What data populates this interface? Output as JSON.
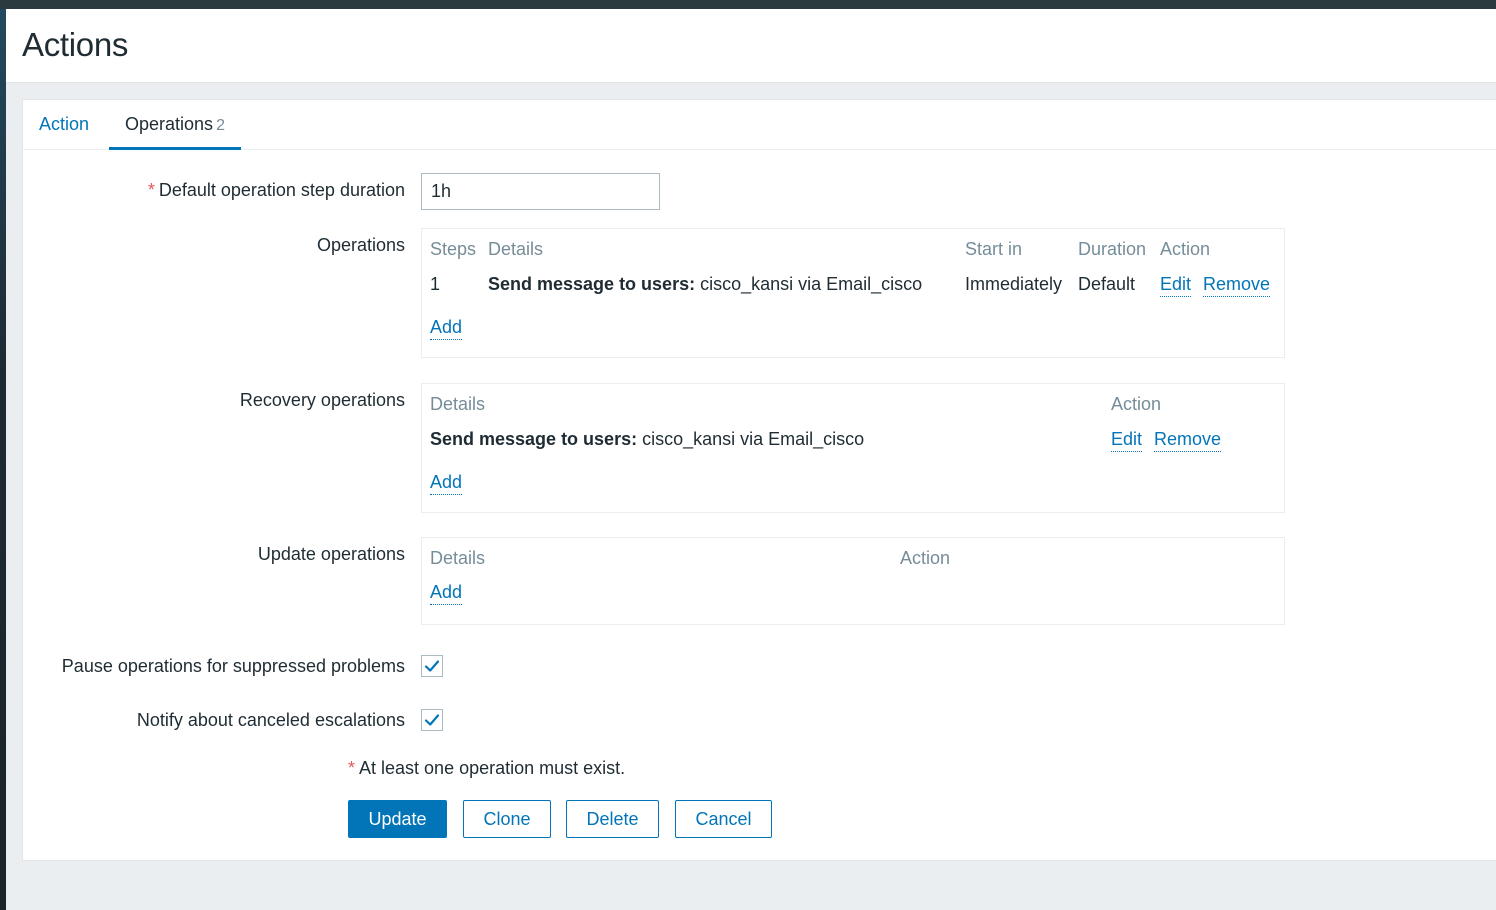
{
  "page": {
    "title": "Actions"
  },
  "tabs": [
    {
      "label": "Action"
    },
    {
      "label": "Operations",
      "count": "2"
    }
  ],
  "form": {
    "step_duration": {
      "label": "Default operation step duration",
      "value": "1h",
      "required_mark": "*"
    },
    "operations": {
      "label": "Operations",
      "headers": {
        "steps": "Steps",
        "details": "Details",
        "start_in": "Start in",
        "duration": "Duration",
        "action": "Action"
      },
      "rows": [
        {
          "step": "1",
          "details_bold": "Send message to users:",
          "details_rest": "cisco_kansi via Email_cisco",
          "start_in": "Immediately",
          "duration": "Default",
          "edit": "Edit",
          "remove": "Remove"
        }
      ],
      "add_label": "Add"
    },
    "recovery_operations": {
      "label": "Recovery operations",
      "headers": {
        "details": "Details",
        "action": "Action"
      },
      "rows": [
        {
          "details_bold": "Send message to users:",
          "details_rest": "cisco_kansi via Email_cisco",
          "edit": "Edit",
          "remove": "Remove"
        }
      ],
      "add_label": "Add"
    },
    "update_operations": {
      "label": "Update operations",
      "headers": {
        "details": "Details",
        "action": "Action"
      },
      "add_label": "Add"
    },
    "pause_suppressed": {
      "label": "Pause operations for suppressed problems",
      "checked": true
    },
    "notify_canceled": {
      "label": "Notify about canceled escalations",
      "checked": true
    },
    "note": {
      "mark": "*",
      "text": "At least one operation must exist."
    }
  },
  "buttons": {
    "update": "Update",
    "clone": "Clone",
    "delete": "Delete",
    "cancel": "Cancel"
  },
  "colors": {
    "link": "#0275b8",
    "required": "#e45959",
    "header_text": "#768d99"
  }
}
